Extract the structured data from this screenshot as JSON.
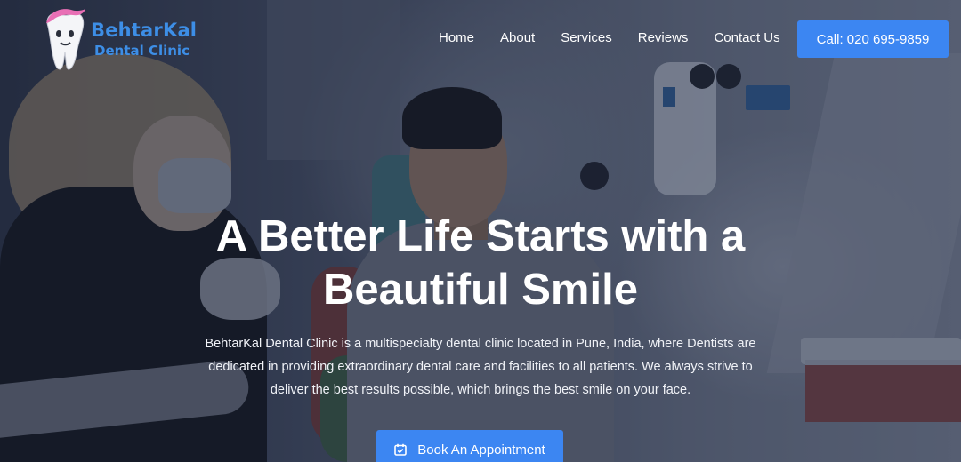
{
  "brand": {
    "name": "BehtarKal",
    "subtitle": "Dental Clinic",
    "color": "#3d8ee6",
    "icon": "tooth-logo-icon"
  },
  "nav": {
    "items": [
      {
        "label": "Home"
      },
      {
        "label": "About"
      },
      {
        "label": "Services"
      },
      {
        "label": "Reviews"
      },
      {
        "label": "Contact Us"
      }
    ]
  },
  "header": {
    "call_label": "Call: 020 695-9859"
  },
  "hero": {
    "headline_line1": "A Better Life Starts with a",
    "headline_line2": "Beautiful Smile",
    "intro_line1": "BehtarKal Dental Clinic is a multispecialty dental clinic located in Pune, India, where Dentists are",
    "intro_line2": "dedicated in providing extraordinary dental care and facilities to all patients. We always strive to",
    "intro_line3": "deliver the best results possible, which brings the best smile on your face.",
    "cta_label": "Book An Appointment",
    "cta_icon": "calendar-check-icon"
  },
  "colors": {
    "accent": "#3c86f2",
    "overlay": "#181f34"
  }
}
